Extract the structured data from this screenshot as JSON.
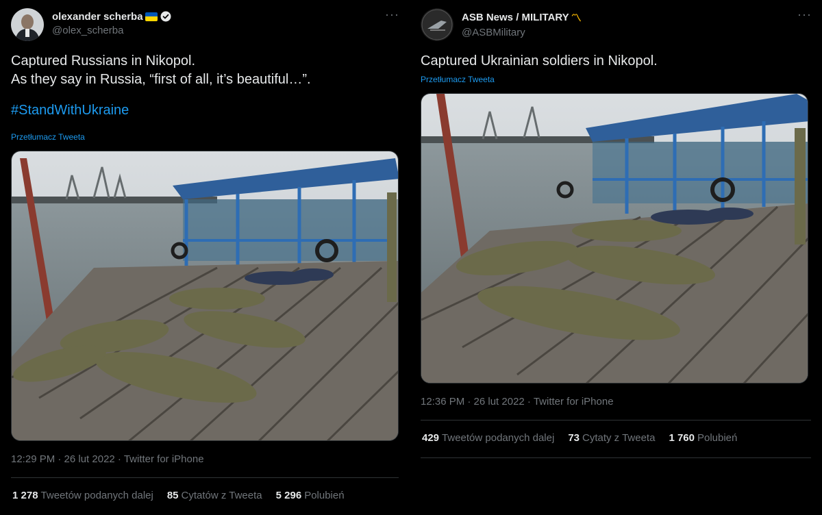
{
  "left": {
    "user": {
      "name": "olexander scherba",
      "handle": "@olex_scherba"
    },
    "text_lines": [
      "Captured Russians in Nikopol.",
      "As they say in Russia, “first of all, it’s beautiful…”."
    ],
    "hashtag": "#StandWithUkraine",
    "translate": "Przetłumacz Tweeta",
    "meta": "12:29 PM · 26 lut 2022 · Twitter for iPhone",
    "stats": [
      {
        "count": "1 278",
        "label": "Tweetów podanych dalej"
      },
      {
        "count": "85",
        "label": "Cytatów z Tweeta"
      },
      {
        "count": "5 296",
        "label": "Polubień"
      }
    ]
  },
  "right": {
    "user": {
      "name": "ASB News / MILITARY",
      "handle": "@ASBMilitary",
      "name_emoji": "〽"
    },
    "text_lines": [
      "Captured Ukrainian soldiers in Nikopol."
    ],
    "translate": "Przetłumacz Tweeta",
    "meta": "12:36 PM · 26 lut 2022 · Twitter for iPhone",
    "stats": [
      {
        "count": "429",
        "label": "Tweetów podanych dalej"
      },
      {
        "count": "73",
        "label": "Cytaty z Tweeta"
      },
      {
        "count": "1 760",
        "label": "Polubień"
      }
    ]
  },
  "icons": {
    "more": "more-icon",
    "verified": "verified-badge-icon",
    "flag": "ukraine-flag-icon"
  },
  "colors": {
    "link": "#1d9bf0",
    "text": "#e7e9ea",
    "muted": "#71767b",
    "divider": "#2f3336",
    "background": "#000000"
  }
}
